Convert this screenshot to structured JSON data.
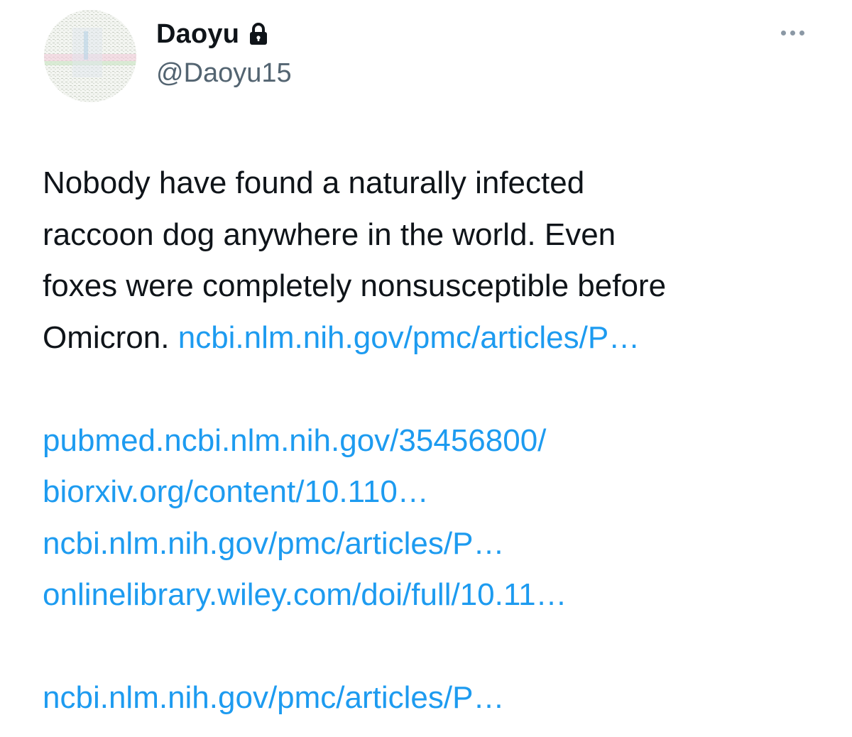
{
  "author": {
    "display_name": "Daoyu",
    "handle": "@Daoyu15",
    "protected_icon": "lock-icon",
    "avatar": "abstract-pattern-avatar"
  },
  "more_menu_icon": "more-horizontal-icon",
  "tweet": {
    "text_line_1": "Nobody have found a naturally infected",
    "text_line_2": "raccoon dog anywhere in the world. Even",
    "text_line_3": "foxes were completely nonsusceptible before",
    "text_line_4": "Omicron.",
    "links": [
      "ncbi.nlm.nih.gov/pmc/articles/P…",
      "pubmed.ncbi.nlm.nih.gov/35456800/",
      "biorxiv.org/content/10.110…",
      "ncbi.nlm.nih.gov/pmc/articles/P…",
      "onlinelibrary.wiley.com/doi/full/10.11…",
      "ncbi.nlm.nih.gov/pmc/articles/P…"
    ]
  },
  "colors": {
    "text": "#0f1419",
    "secondary_text": "#536471",
    "link": "#1d9bf0",
    "background": "#ffffff"
  }
}
